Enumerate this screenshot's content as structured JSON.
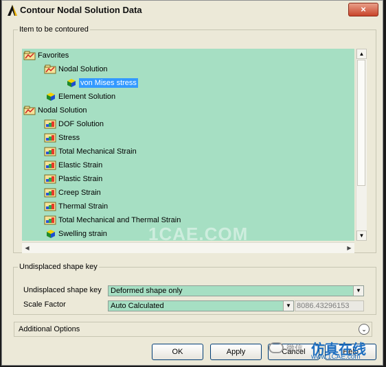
{
  "window": {
    "title": "Contour Nodal Solution Data",
    "close_label": "×"
  },
  "item_group": {
    "legend": "Item to be contoured",
    "tree": [
      {
        "label": "Favorites",
        "level": 0,
        "icon": "folder-plot-icon",
        "selected": false
      },
      {
        "label": "Nodal Solution",
        "level": 1,
        "icon": "folder-plot-icon",
        "selected": false
      },
      {
        "label": "von Mises stress",
        "level": 2,
        "icon": "cube-icon",
        "selected": true
      },
      {
        "label": "Element Solution",
        "level": 1,
        "icon": "cube-icon",
        "selected": false
      },
      {
        "label": "Nodal Solution",
        "level": 0,
        "icon": "folder-plot-icon",
        "selected": false
      },
      {
        "label": "DOF Solution",
        "level": 1,
        "icon": "contour-icon",
        "selected": false
      },
      {
        "label": "Stress",
        "level": 1,
        "icon": "contour-icon",
        "selected": false
      },
      {
        "label": "Total Mechanical Strain",
        "level": 1,
        "icon": "contour-icon",
        "selected": false
      },
      {
        "label": "Elastic Strain",
        "level": 1,
        "icon": "contour-icon",
        "selected": false
      },
      {
        "label": "Plastic Strain",
        "level": 1,
        "icon": "contour-icon",
        "selected": false
      },
      {
        "label": "Creep Strain",
        "level": 1,
        "icon": "contour-icon",
        "selected": false
      },
      {
        "label": "Thermal Strain",
        "level": 1,
        "icon": "contour-icon",
        "selected": false
      },
      {
        "label": "Total Mechanical and Thermal Strain",
        "level": 1,
        "icon": "contour-icon",
        "selected": false
      },
      {
        "label": "Swelling strain",
        "level": 1,
        "icon": "cube-icon",
        "selected": false
      }
    ],
    "watermark": "1CAE.COM"
  },
  "shape_group": {
    "legend": "Undisplaced shape key",
    "undisplaced_label": "Undisplaced shape key",
    "undisplaced_value": "Deformed shape only",
    "scale_label": "Scale Factor",
    "scale_mode": "Auto Calculated",
    "scale_value": "8086.43296153"
  },
  "additional_options": {
    "label": "Additional Options"
  },
  "buttons": {
    "ok": "OK",
    "apply": "Apply",
    "cancel": "Cancel",
    "help": "Help"
  },
  "overlay": {
    "weixin": "微信",
    "brand": "仿真在线",
    "url": "www.1CAE.com"
  },
  "colors": {
    "tree_bg": "#a6dfc3",
    "selection": "#3399ff",
    "dialog_bg": "#ece9d8"
  }
}
